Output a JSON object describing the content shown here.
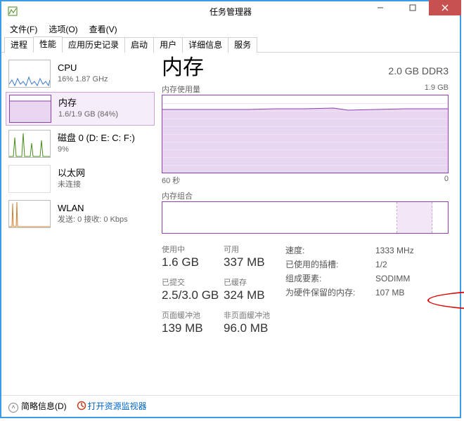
{
  "title": "任务管理器",
  "menus": {
    "file": "文件(F)",
    "options": "选项(O)",
    "view": "查看(V)"
  },
  "tabs": [
    "进程",
    "性能",
    "应用历史记录",
    "启动",
    "用户",
    "详细信息",
    "服务"
  ],
  "active_tab_index": 1,
  "sidebar": [
    {
      "name": "CPU",
      "sub": "16%  1.87 GHz",
      "color": "#3a7bcc"
    },
    {
      "name": "内存",
      "sub": "1.6/1.9 GB (84%)",
      "color": "#8e3fb0"
    },
    {
      "name": "磁盘 0 (D: E: C: F:)",
      "sub": "9%",
      "color": "#4a8a1c"
    },
    {
      "name": "以太网",
      "sub": "未连接",
      "color": "#bbb"
    },
    {
      "name": "WLAN",
      "sub": "发送: 0  接收: 0 Kbps",
      "color": "#d08030"
    }
  ],
  "selected_sidebar_index": 1,
  "main": {
    "title": "内存",
    "subtitle": "2.0 GB DDR3",
    "usage_label": "内存使用量",
    "usage_max": "1.9 GB",
    "xaxis_left": "60 秒",
    "xaxis_right": "0",
    "composition_label": "内存组合",
    "stats_left": [
      {
        "label": "使用中",
        "value": "1.6 GB"
      },
      {
        "label": "可用",
        "value": "337 MB"
      },
      {
        "label": "已提交",
        "value": "2.5/3.0 GB"
      },
      {
        "label": "已缓存",
        "value": "324 MB"
      },
      {
        "label": "页面缓冲池",
        "value": "139 MB"
      },
      {
        "label": "非页面缓冲池",
        "value": "96.0 MB"
      }
    ],
    "stats_right": [
      {
        "k": "速度:",
        "v": "1333 MHz"
      },
      {
        "k": "已使用的插槽:",
        "v": "1/2"
      },
      {
        "k": "组成要素:",
        "v": "SODIMM"
      },
      {
        "k": "为硬件保留的内存:",
        "v": "107 MB"
      }
    ]
  },
  "footer": {
    "brief": "简略信息(D)",
    "resmon": "打开资源监视器"
  },
  "chart_data": {
    "type": "area",
    "title": "内存使用量",
    "xlabel": "60 秒 → 0",
    "ylabel": "GB",
    "ylim": [
      0,
      1.9
    ],
    "x": [
      60,
      55,
      50,
      45,
      40,
      35,
      30,
      25,
      20,
      15,
      10,
      5,
      0
    ],
    "values": [
      1.56,
      1.56,
      1.56,
      1.57,
      1.57,
      1.58,
      1.54,
      1.55,
      1.57,
      1.57,
      1.57,
      1.57,
      1.57
    ]
  }
}
